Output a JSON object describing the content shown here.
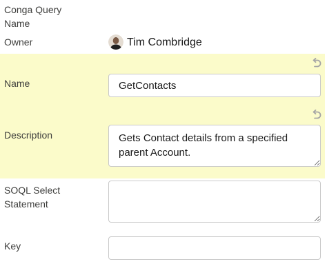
{
  "fields": {
    "conga_query_name": {
      "label_line1": "Conga Query",
      "label_line2": "Name"
    },
    "owner": {
      "label": "Owner",
      "value": "Tim Combridge"
    },
    "name": {
      "label": "Name",
      "value": "GetContacts"
    },
    "description": {
      "label": "Description",
      "value": "Gets Contact details from a specified parent Account."
    },
    "soql_select_statement": {
      "label_line1": "SOQL Select",
      "label_line2": "Statement",
      "value": ""
    },
    "key": {
      "label": "Key",
      "value": ""
    }
  },
  "colors": {
    "edited_highlight": "#fbfbca",
    "border": "#c9c9c9"
  },
  "icons": {
    "undo": "undo-icon",
    "avatar": "user-avatar"
  }
}
